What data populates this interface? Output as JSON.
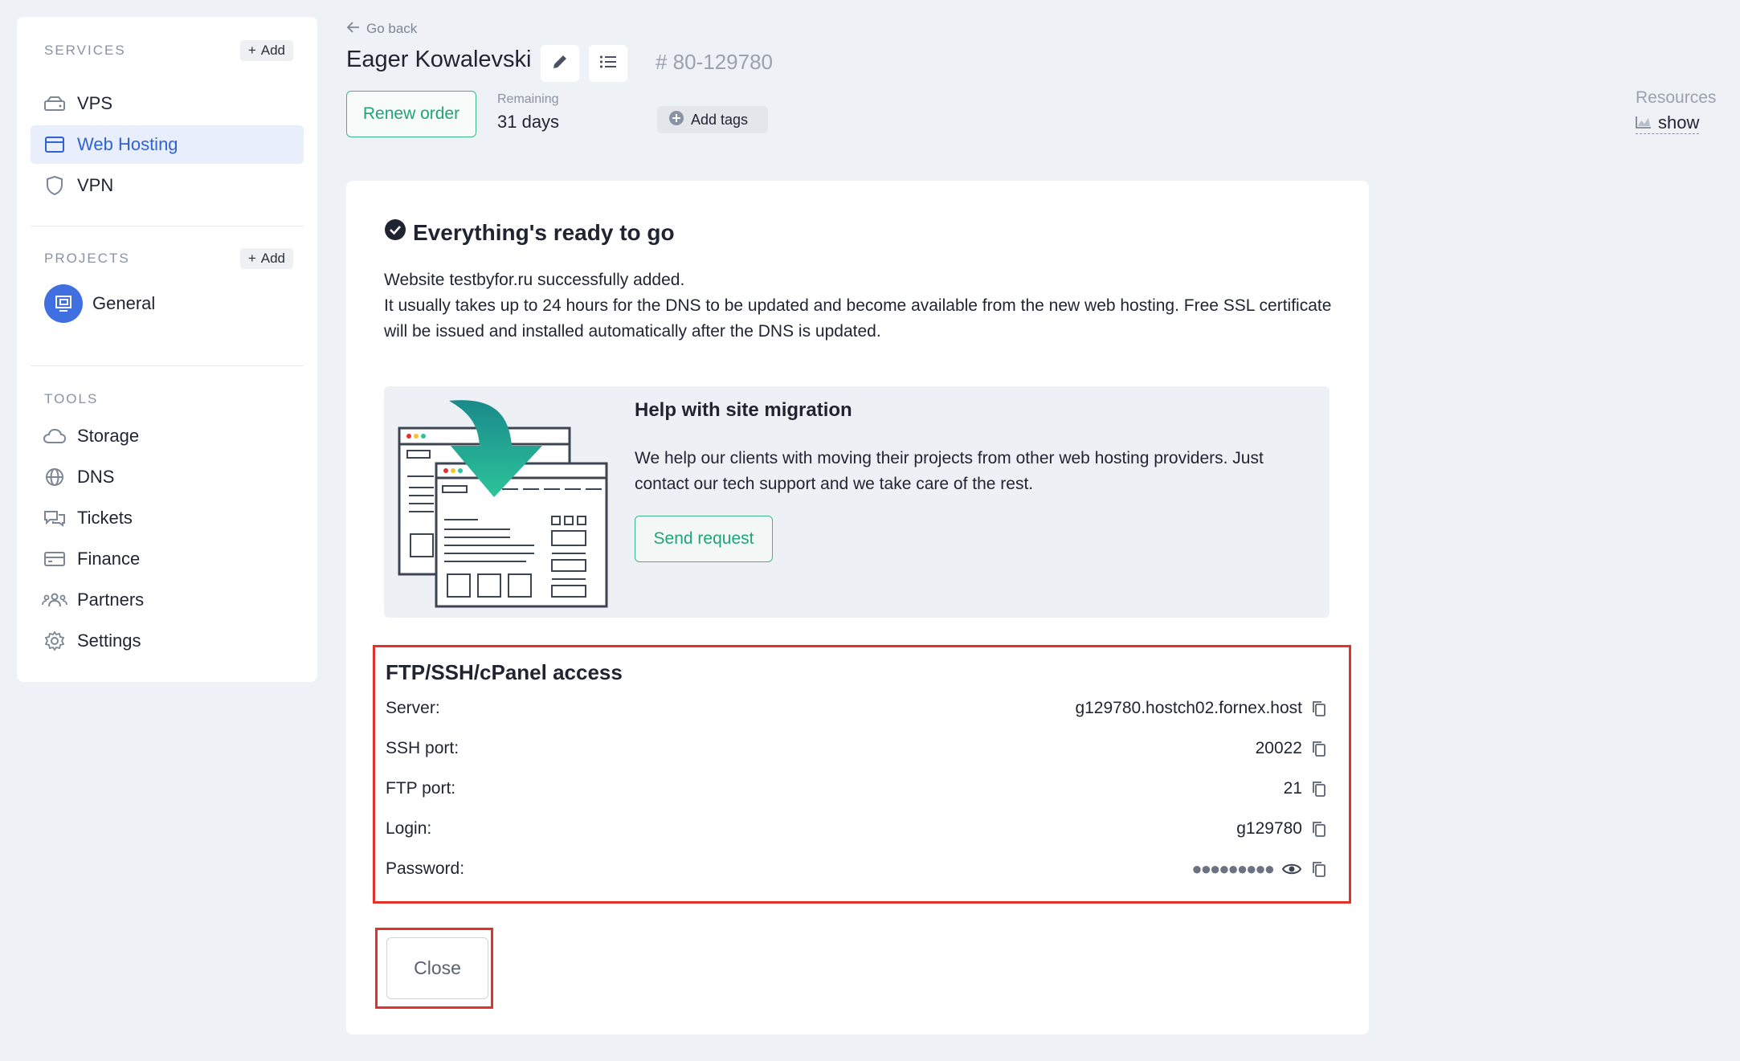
{
  "sidebar": {
    "services_title": "SERVICES",
    "services_add": "Add",
    "services": [
      {
        "label": "VPS",
        "icon": "server-icon"
      },
      {
        "label": "Web Hosting",
        "icon": "browser-window-icon",
        "active": true
      },
      {
        "label": "VPN",
        "icon": "shield-icon"
      }
    ],
    "projects_title": "PROJECTS",
    "projects_add": "Add",
    "project": {
      "label": "General"
    },
    "tools_title": "TOOLS",
    "tools": [
      {
        "label": "Storage",
        "icon": "cloud-icon"
      },
      {
        "label": "DNS",
        "icon": "globe-icon"
      },
      {
        "label": "Tickets",
        "icon": "chat-icon"
      },
      {
        "label": "Finance",
        "icon": "card-icon"
      },
      {
        "label": "Partners",
        "icon": "users-icon"
      },
      {
        "label": "Settings",
        "icon": "gear-icon"
      }
    ]
  },
  "header": {
    "go_back": "Go back",
    "title": "Eager Kowalevski",
    "order_id": "# 80-129780",
    "renew": "Renew order",
    "remaining_label": "Remaining",
    "remaining_value": "31 days",
    "add_tags": "Add tags",
    "resources_label": "Resources",
    "resources_show": "show"
  },
  "card": {
    "ready_title": "Everything's ready to go",
    "msg_line1": "Website testbyfor.ru successfully added.",
    "msg_line2": "It usually takes up to 24 hours for the DNS to be updated and become available from the new web hosting. Free SSL certificate will be issued and installed automatically after the DNS is updated.",
    "migration": {
      "title": "Help with site migration",
      "text": "We help our clients with moving their projects from other web hosting providers. Just contact our tech support and we take care of the rest.",
      "button": "Send request"
    },
    "access": {
      "title": "FTP/SSH/cPanel access",
      "rows": [
        {
          "key": "Server:",
          "value": "g129780.hostch02.fornex.host"
        },
        {
          "key": "SSH port:",
          "value": "20022"
        },
        {
          "key": "FTP port:",
          "value": "21"
        },
        {
          "key": "Login:",
          "value": "g129780"
        },
        {
          "key": "Password:",
          "value": "●●●●●●●●●"
        }
      ]
    },
    "close": "Close"
  },
  "colors": {
    "accent_green": "#1fa478",
    "accent_blue": "#2f62d6",
    "highlight_red": "#e1322c"
  }
}
